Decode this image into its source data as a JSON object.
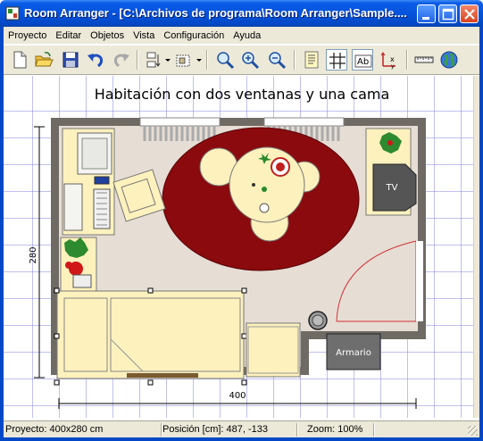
{
  "window": {
    "title": "Room Arranger - [C:\\Archivos de programa\\Room Arranger\\Sample...."
  },
  "menubar": {
    "items": [
      "Proyecto",
      "Editar",
      "Objetos",
      "Vista",
      "Configuración",
      "Ayuda"
    ]
  },
  "toolbar": {
    "buttons": [
      "new-icon",
      "open-icon",
      "save-icon",
      "undo-icon",
      "redo-icon",
      "align-icon",
      "group-icon",
      "zoom-fit-icon",
      "zoom-in-icon",
      "zoom-out-icon",
      "notes-icon",
      "grid-icon",
      "labels-icon",
      "dimensions-icon",
      "ruler-icon",
      "globe-icon"
    ],
    "pressed": [
      "grid-icon",
      "labels-icon"
    ]
  },
  "plan": {
    "title": "Habitación con dos ventanas y una cama",
    "dim_width": "400",
    "dim_height": "280",
    "tv_label": "TV",
    "wardrobe_label": "Armario"
  },
  "statusbar": {
    "project": "Proyecto: 400x280 cm",
    "position": "Posición [cm]: 487, -133",
    "zoom": "Zoom: 100%"
  },
  "colors": {
    "wall": "#6f6a64",
    "floor": "#e6ddd5",
    "rug": "#8a0a0e",
    "furniture": "#fdf1bd",
    "door": "#d43030",
    "grid": "#8282dc"
  }
}
